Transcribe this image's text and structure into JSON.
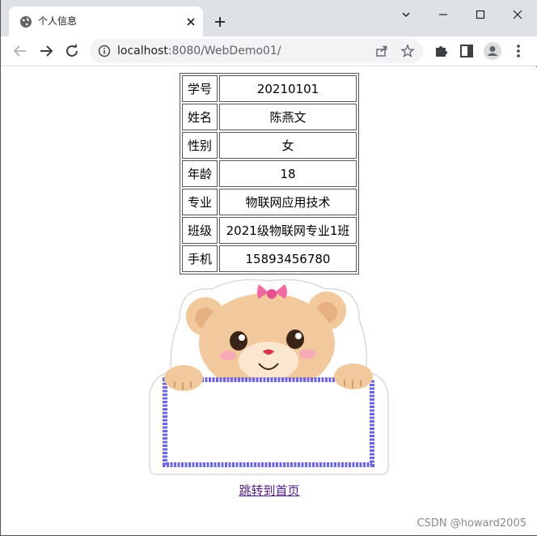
{
  "tab": {
    "title": "个人信息"
  },
  "address": {
    "host": "localhost",
    "rest": ":8080/WebDemo01/"
  },
  "table": {
    "rows": [
      {
        "label": "学号",
        "value": "20210101"
      },
      {
        "label": "姓名",
        "value": "陈燕文"
      },
      {
        "label": "性别",
        "value": "女"
      },
      {
        "label": "年龄",
        "value": "18"
      },
      {
        "label": "专业",
        "value": "物联网应用技术"
      },
      {
        "label": "班级",
        "value": "2021级物联网专业1班"
      },
      {
        "label": "手机",
        "value": "15893456780"
      }
    ]
  },
  "link": {
    "text": "跳转到首页"
  },
  "watermark": {
    "text": "CSDN @howard2005"
  },
  "colors": {
    "tabstrip": "#dee1e6",
    "link": "#551a8b",
    "bear_fur": "#f2c99c",
    "board_border": "#6b63f5",
    "bow": "#f06aa0"
  },
  "icons": {
    "favicon": "globe-icon",
    "info": "info-icon",
    "share": "share-icon",
    "star": "star-icon",
    "extensions": "puzzle-icon",
    "sidepanel": "side-panel-icon",
    "profile": "profile-icon",
    "menu": "kebab-menu-icon"
  }
}
